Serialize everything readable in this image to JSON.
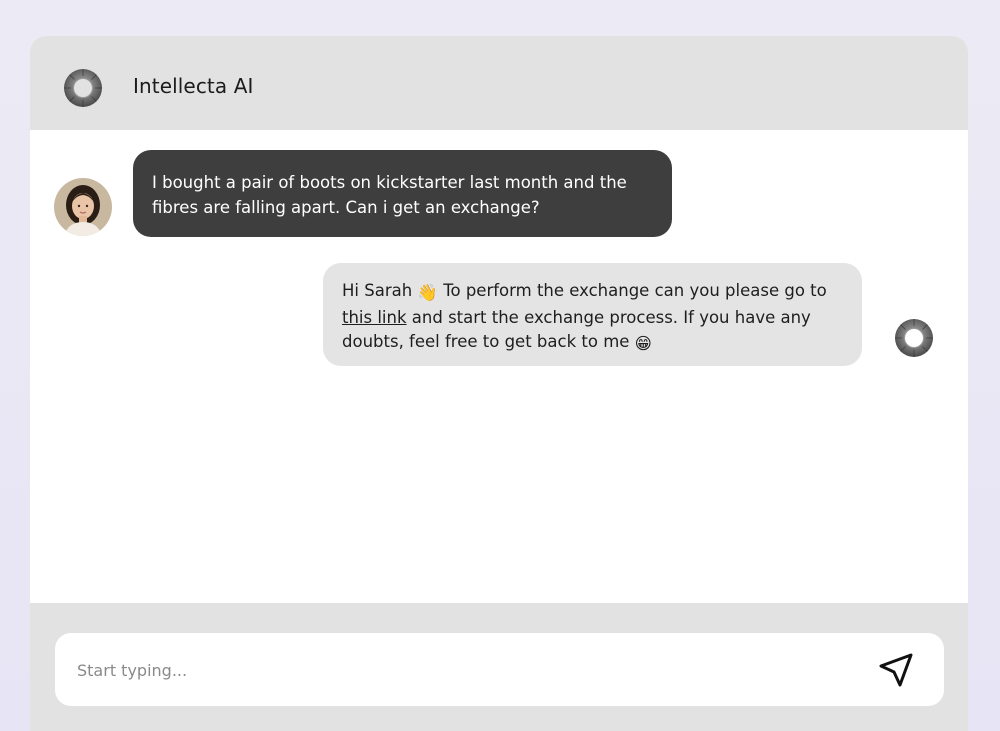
{
  "app": {
    "title": "Intellecta AI",
    "logo_icon": "bot-logo-icon"
  },
  "messages": [
    {
      "sender": "user",
      "avatar_icon": "user-avatar",
      "text": "I bought a pair of boots on kickstarter last month and the fibres are falling apart. Can i get an exchange?"
    },
    {
      "sender": "bot",
      "avatar_icon": "bot-logo-icon",
      "text_part1": "Hi Sarah ",
      "emoji_wave": "👋",
      "text_part2": " To perform the exchange can you please go to ",
      "link_text": "this link",
      "text_part3": " and start the exchange process. If you have any doubts, feel free to get back to me ",
      "emoji_grin": "😁"
    }
  ],
  "composer": {
    "placeholder": "Start typing...",
    "value": "",
    "send_icon": "send-icon"
  },
  "colors": {
    "header_bg": "#e2e2e2",
    "user_bubble": "#3e3e3e",
    "bot_bubble": "#e4e4e4",
    "page_bg": "#eceaf4"
  }
}
